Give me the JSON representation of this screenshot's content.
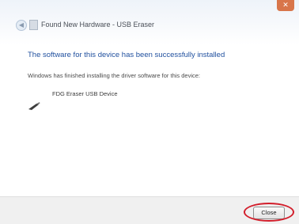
{
  "window": {
    "title": "Found New Hardware - USB Eraser",
    "close_glyph": "✕",
    "back_glyph": "◀"
  },
  "main": {
    "heading": "The software for this device has been successfully installed",
    "subtext": "Windows has finished installing the driver software for this device:",
    "device_name": "FDG Eraser USB Device",
    "device_icon": "usb-device-icon"
  },
  "footer": {
    "close_label": "Close"
  },
  "colors": {
    "heading": "#1f4f9e",
    "highlight_ring": "#d21e2b"
  }
}
